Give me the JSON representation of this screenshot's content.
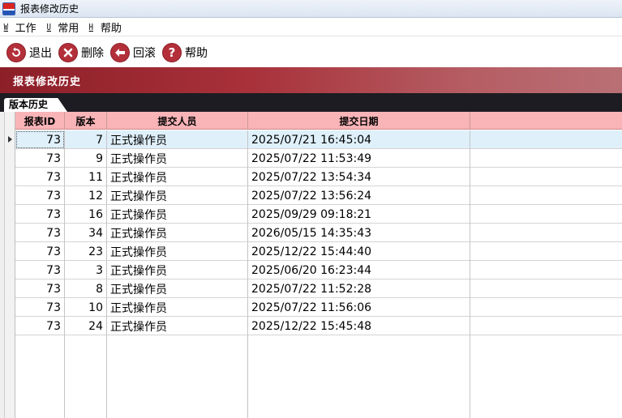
{
  "window": {
    "title": "报表修改历史"
  },
  "menu": [
    {
      "key": "W",
      "label": "工作"
    },
    {
      "key": "U",
      "label": "常用"
    },
    {
      "key": "H",
      "label": "帮助"
    }
  ],
  "toolbar": {
    "exit_label": "退出",
    "delete_label": "删除",
    "rollback_label": "回滚",
    "help_label": "帮助"
  },
  "section": {
    "title": "报表修改历史"
  },
  "tab": {
    "label": "版本历史"
  },
  "table": {
    "columns": [
      "报表ID",
      "版本",
      "提交人员",
      "提交日期"
    ],
    "rows": [
      {
        "id": "73",
        "version": "7",
        "user": "正式操作员",
        "date": "2025/07/21 16:45:04"
      },
      {
        "id": "73",
        "version": "9",
        "user": "正式操作员",
        "date": "2025/07/22 11:53:49"
      },
      {
        "id": "73",
        "version": "11",
        "user": "正式操作员",
        "date": "2025/07/22 13:54:34"
      },
      {
        "id": "73",
        "version": "12",
        "user": "正式操作员",
        "date": "2025/07/22 13:56:24"
      },
      {
        "id": "73",
        "version": "16",
        "user": "正式操作员",
        "date": "2025/09/29 09:18:21"
      },
      {
        "id": "73",
        "version": "34",
        "user": "正式操作员",
        "date": "2026/05/15 14:35:43"
      },
      {
        "id": "73",
        "version": "23",
        "user": "正式操作员",
        "date": "2025/12/22 15:44:40"
      },
      {
        "id": "73",
        "version": "3",
        "user": "正式操作员",
        "date": "2025/06/20 16:23:44"
      },
      {
        "id": "73",
        "version": "8",
        "user": "正式操作员",
        "date": "2025/07/22 11:52:28"
      },
      {
        "id": "73",
        "version": "10",
        "user": "正式操作员",
        "date": "2025/07/22 11:56:06"
      },
      {
        "id": "73",
        "version": "24",
        "user": "正式操作员",
        "date": "2025/12/22 15:45:48"
      }
    ]
  },
  "colors": {
    "accent_red": "#a8313a",
    "header_pink": "#f9b4b8",
    "selected_row": "#dff0fb"
  }
}
